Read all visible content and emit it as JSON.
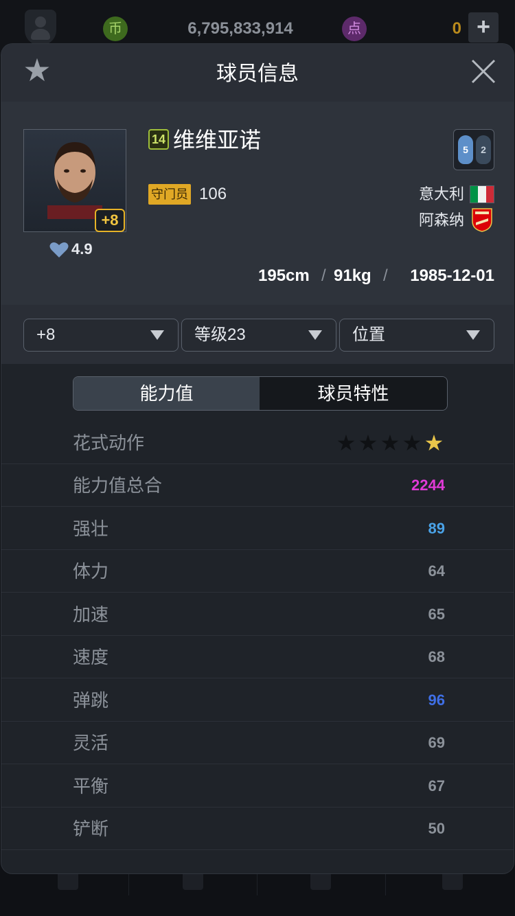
{
  "topbar": {
    "coin_icon_label": "币",
    "coins": "6,795,833,914",
    "point_icon_label": "点",
    "points": "0",
    "plus_label": "+"
  },
  "modal": {
    "title": "球员信息"
  },
  "player": {
    "season_badge": "14",
    "name": "维维亚诺",
    "enhance_badge": "+8",
    "likes": "4.9",
    "position": "守门员",
    "ovr": "106",
    "nation": "意大利",
    "club": "阿森纳",
    "height": "195cm",
    "weight": "91kg",
    "dob": "1985-12-01",
    "sep": "/",
    "weak_foot_left": "5",
    "weak_foot_right": "2"
  },
  "filters": {
    "enhance": "+8",
    "level": "等级23",
    "position": "位置"
  },
  "tabs": {
    "abilities": "能力值",
    "traits": "球员特性"
  },
  "skill_moves": {
    "label": "花式动作",
    "stars_on": 1,
    "stars_total": 5
  },
  "stats": [
    {
      "label": "能力值总合",
      "value": "2244",
      "color": "#e03ad6"
    },
    {
      "label": "强壮",
      "value": "89",
      "color": "#4aa3e8"
    },
    {
      "label": "体力",
      "value": "64",
      "color": "#8c929a"
    },
    {
      "label": "加速",
      "value": "65",
      "color": "#8c929a"
    },
    {
      "label": "速度",
      "value": "68",
      "color": "#8c929a"
    },
    {
      "label": "弹跳",
      "value": "96",
      "color": "#3f6fe6"
    },
    {
      "label": "灵活",
      "value": "69",
      "color": "#8c929a"
    },
    {
      "label": "平衡",
      "value": "67",
      "color": "#8c929a"
    },
    {
      "label": "铲断",
      "value": "50",
      "color": "#8c929a"
    }
  ],
  "colors": {
    "accent_gold": "#e0a825",
    "italy_green": "#009246",
    "italy_white": "#f1f2f1",
    "italy_red": "#ce2b37",
    "arsenal_red": "#db0007"
  }
}
